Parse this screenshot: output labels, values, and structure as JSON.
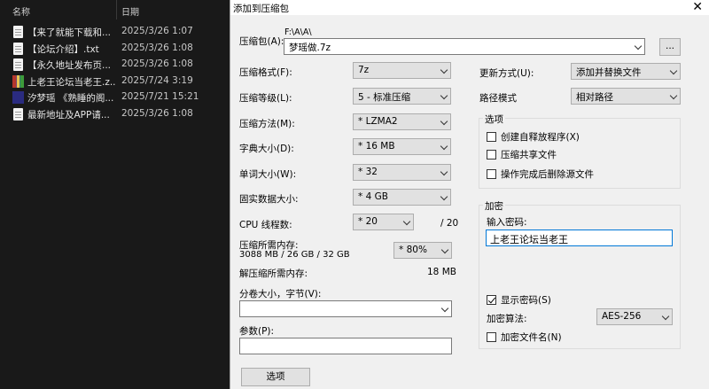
{
  "explorer": {
    "col_name": "名称",
    "col_date": "日期",
    "files": [
      {
        "name": "【来了就能下载和...",
        "date": "2025/3/26 1:07",
        "icon": "text-file-icon"
      },
      {
        "name": "【论坛介绍】.txt",
        "date": "2025/3/26 1:08",
        "icon": "text-file-icon"
      },
      {
        "name": "【永久地址发布页...",
        "date": "2025/3/26 1:08",
        "icon": "text-file-icon"
      },
      {
        "name": "上老王论坛当老王.z...",
        "date": "2025/7/24 3:19",
        "icon": "archive-icon"
      },
      {
        "name": "汐梦瑶 《熟睡的阁...",
        "date": "2025/7/21 15:21",
        "icon": "video-file-icon"
      },
      {
        "name": "最新地址及APP请...",
        "date": "2025/3/26 1:08",
        "icon": "text-file-icon"
      }
    ]
  },
  "dialog": {
    "title": "添加到压缩包",
    "close": "✕",
    "archive_label": "压缩包(A):",
    "archive_path": "F:\\A\\A\\",
    "archive_name": "梦瑶做.7z",
    "browse_label": "...",
    "format_label": "压缩格式(F):",
    "format_value": "7z",
    "level_label": "压缩等级(L):",
    "level_value": "5 - 标准压缩",
    "method_label": "压缩方法(M):",
    "method_value": "* LZMA2",
    "dict_label": "字典大小(D):",
    "dict_value": "* 16 MB",
    "word_label": "单词大小(W):",
    "word_value": "* 32",
    "solid_label": "固实数据大小:",
    "solid_value": "* 4 GB",
    "threads_label": "CPU 线程数:",
    "threads_value": "* 20",
    "threads_total": "/ 20",
    "mem_label": "压缩所需内存:",
    "mem_value": "3088 MB / 26 GB / 32 GB",
    "mem_percent": "* 80%",
    "decomp_label": "解压缩所需内存:",
    "decomp_value": "18 MB",
    "split_label": "分卷大小，字节(V):",
    "split_value": "",
    "params_label": "参数(P):",
    "params_value": "",
    "options_button": "选项",
    "update_label": "更新方式(U):",
    "update_value": "添加并替换文件",
    "path_label": "路径模式",
    "path_value": "相对路径",
    "options_group": "选项",
    "opt_sfx": "创建自释放程序(X)",
    "opt_shared": "压缩共享文件",
    "opt_delete": "操作完成后删除源文件",
    "encrypt_group": "加密",
    "pwd_label": "输入密码:",
    "pwd_value": "上老王论坛当老王",
    "show_pwd": "显示密码(S)",
    "enc_method_label": "加密算法:",
    "enc_method_value": "AES-256",
    "enc_names": "加密文件名(N)"
  }
}
